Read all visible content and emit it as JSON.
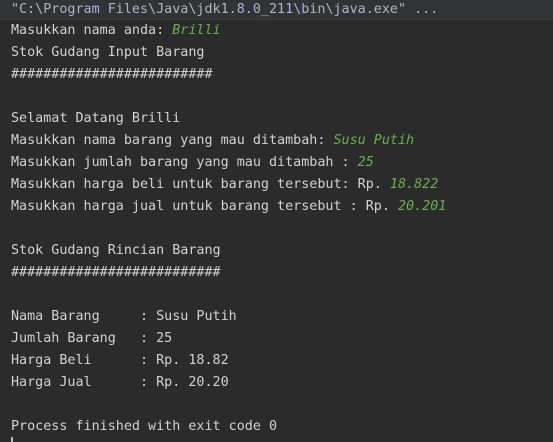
{
  "console": {
    "command": "\"C:\\Program Files\\Java\\jdk1.8.0_211\\bin\\java.exe\" ...",
    "lines": [
      {
        "text": "Masukkan nama anda: ",
        "input": "Brilli"
      },
      {
        "text": "Stok Gudang Input Barang"
      },
      {
        "text": "#########################"
      },
      {
        "text": ""
      },
      {
        "text": "Selamat Datang Brilli"
      },
      {
        "text": "Masukkan nama barang yang mau ditambah: ",
        "input": "Susu Putih"
      },
      {
        "text": "Masukkan jumlah barang yang mau ditambah : ",
        "input": "25"
      },
      {
        "text": "Masukkan harga beli untuk barang tersebut: Rp. ",
        "input": "18.822"
      },
      {
        "text": "Masukkan harga jual untuk barang tersebut : Rp. ",
        "input": "20.201"
      },
      {
        "text": ""
      },
      {
        "text": "Stok Gudang Rincian Barang"
      },
      {
        "text": "##########################"
      },
      {
        "text": ""
      },
      {
        "text": "Nama Barang     : Susu Putih"
      },
      {
        "text": "Jumlah Barang   : 25"
      },
      {
        "text": "Harga Beli      : Rp. 18.82"
      },
      {
        "text": "Harga Jual      : Rp. 20.20"
      },
      {
        "text": ""
      },
      {
        "text": "Process finished with exit code 0"
      }
    ]
  },
  "colors": {
    "background": "#2b2b2b",
    "text": "#d2d2d2",
    "user_input": "#62b543"
  }
}
